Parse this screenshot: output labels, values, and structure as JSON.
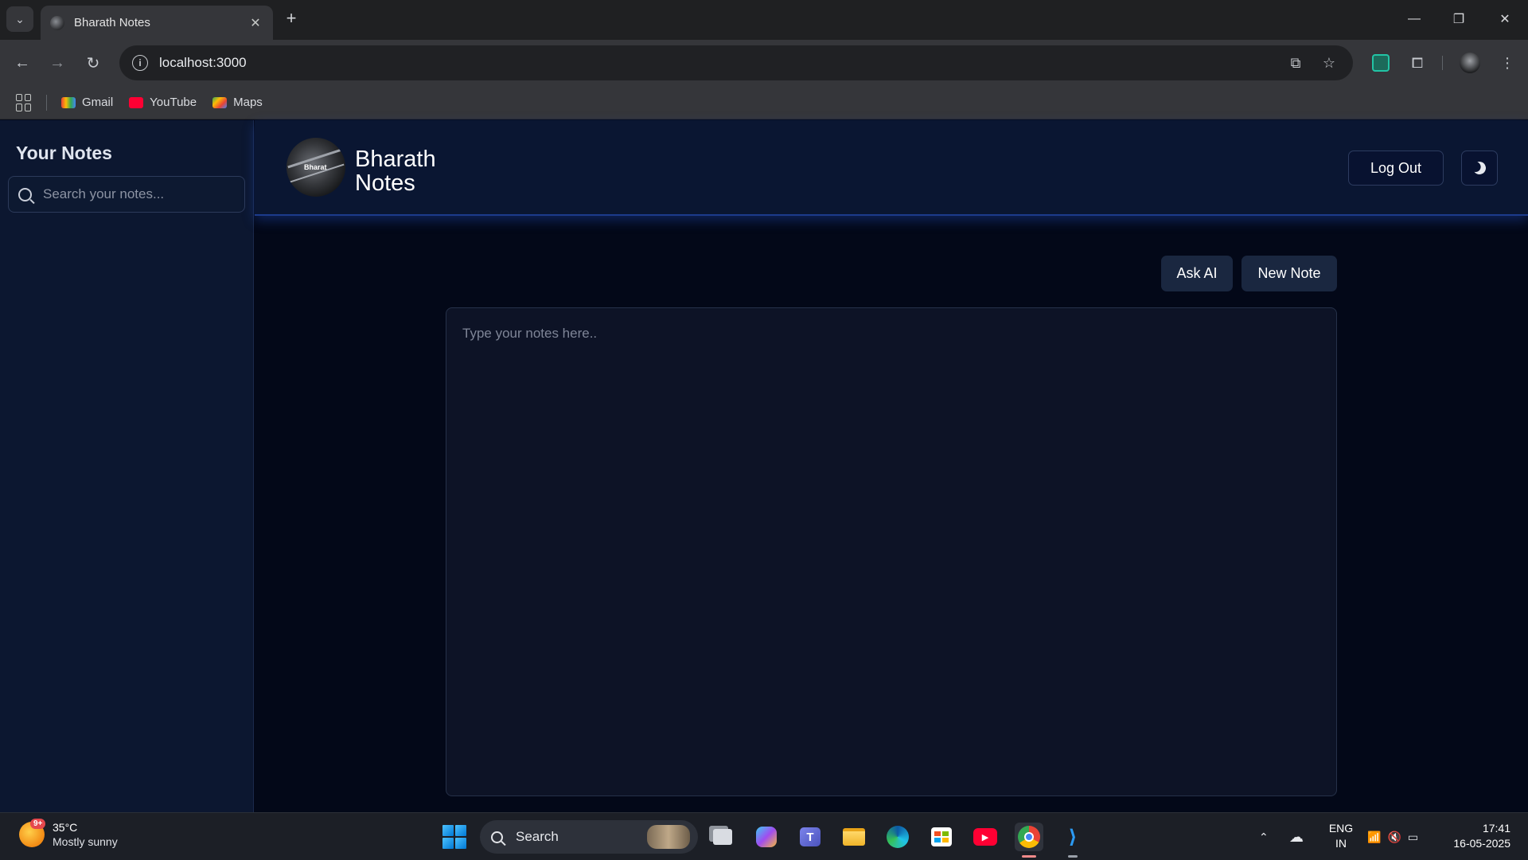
{
  "browser": {
    "tab_title": "Bharath Notes",
    "url": "localhost:3000",
    "bookmarks": [
      {
        "label": "Gmail",
        "icon": "gmail-icon"
      },
      {
        "label": "YouTube",
        "icon": "youtube-icon"
      },
      {
        "label": "Maps",
        "icon": "maps-icon"
      }
    ]
  },
  "sidebar": {
    "title": "Your Notes",
    "search_placeholder": "Search your notes..."
  },
  "header": {
    "logo_text": "Bharat",
    "brand_line1": "Bharath",
    "brand_line2": "Notes",
    "logout_label": "Log Out",
    "theme_toggle_icon": "moon-icon"
  },
  "main": {
    "ask_ai_label": "Ask AI",
    "new_note_label": "New Note",
    "editor_placeholder": "Type your notes here.."
  },
  "taskbar": {
    "weather_temp": "35°C",
    "weather_desc": "Mostly sunny",
    "weather_badge": "9+",
    "search_label": "Search",
    "lang_line1": "ENG",
    "lang_line2": "IN",
    "time": "17:41",
    "date": "16-05-2025"
  },
  "colors": {
    "sidebar_bg": "#0c1730",
    "header_bg": "#0a1632",
    "main_bg": "#030818",
    "button_bg": "#1a2740",
    "accent_glow": "#1c3b8c"
  }
}
